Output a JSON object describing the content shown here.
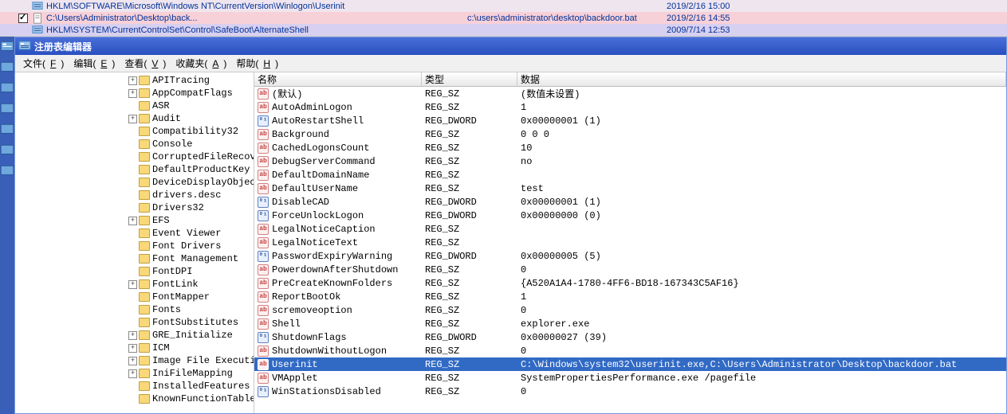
{
  "top_results": [
    {
      "checkbox": null,
      "icon": "reg",
      "path": "HKLM\\SOFTWARE\\Microsoft\\Windows NT\\CurrentVersion\\Winlogon\\Userinit",
      "value": "",
      "date": "2019/2/16 15:00",
      "style": "odd"
    },
    {
      "checkbox": true,
      "icon": "doc",
      "path": "C:\\Users\\Administrator\\Desktop\\back...",
      "value": "c:\\users\\administrator\\desktop\\backdoor.bat",
      "date": "2019/2/16 14:55",
      "style": "pink"
    },
    {
      "checkbox": null,
      "icon": "reg",
      "path": "HKLM\\SYSTEM\\CurrentControlSet\\Control\\SafeBoot\\AlternateShell",
      "value": "",
      "date": "2009/7/14 12:53",
      "style": "blue"
    }
  ],
  "window_title": "注册表编辑器",
  "menu": [
    {
      "label": "文件",
      "key": "F"
    },
    {
      "label": "编辑",
      "key": "E"
    },
    {
      "label": "查看",
      "key": "V"
    },
    {
      "label": "收藏夹",
      "key": "A"
    },
    {
      "label": "帮助",
      "key": "H"
    }
  ],
  "tree_indent": 142,
  "tree": [
    {
      "exp": "+",
      "label": "APITracing"
    },
    {
      "exp": "+",
      "label": "AppCompatFlags"
    },
    {
      "exp": "",
      "label": "ASR"
    },
    {
      "exp": "+",
      "label": "Audit"
    },
    {
      "exp": "",
      "label": "Compatibility32"
    },
    {
      "exp": "",
      "label": "Console"
    },
    {
      "exp": "",
      "label": "CorruptedFileRecove"
    },
    {
      "exp": "",
      "label": "DefaultProductKey"
    },
    {
      "exp": "",
      "label": "DeviceDisplayObject"
    },
    {
      "exp": "",
      "label": "drivers.desc"
    },
    {
      "exp": "",
      "label": "Drivers32"
    },
    {
      "exp": "+",
      "label": "EFS"
    },
    {
      "exp": "",
      "label": "Event Viewer"
    },
    {
      "exp": "",
      "label": "Font Drivers"
    },
    {
      "exp": "",
      "label": "Font Management"
    },
    {
      "exp": "",
      "label": "FontDPI"
    },
    {
      "exp": "+",
      "label": "FontLink"
    },
    {
      "exp": "",
      "label": "FontMapper"
    },
    {
      "exp": "",
      "label": "Fonts"
    },
    {
      "exp": "",
      "label": "FontSubstitutes"
    },
    {
      "exp": "+",
      "label": "GRE_Initialize"
    },
    {
      "exp": "+",
      "label": "ICM"
    },
    {
      "exp": "+",
      "label": "Image File Executi"
    },
    {
      "exp": "+",
      "label": "IniFileMapping"
    },
    {
      "exp": "",
      "label": "InstalledFeatures"
    },
    {
      "exp": "",
      "label": "KnownFunctionTableL"
    }
  ],
  "columns": {
    "name": "名称",
    "type": "类型",
    "data": "数据"
  },
  "values": [
    {
      "icon": "str",
      "name": "(默认)",
      "type": "REG_SZ",
      "data": "(数值未设置)",
      "selected": false
    },
    {
      "icon": "str",
      "name": "AutoAdminLogon",
      "type": "REG_SZ",
      "data": "1",
      "selected": false
    },
    {
      "icon": "bin",
      "name": "AutoRestartShell",
      "type": "REG_DWORD",
      "data": "0x00000001 (1)",
      "selected": false
    },
    {
      "icon": "str",
      "name": "Background",
      "type": "REG_SZ",
      "data": "0 0 0",
      "selected": false
    },
    {
      "icon": "str",
      "name": "CachedLogonsCount",
      "type": "REG_SZ",
      "data": "10",
      "selected": false
    },
    {
      "icon": "str",
      "name": "DebugServerCommand",
      "type": "REG_SZ",
      "data": "no",
      "selected": false
    },
    {
      "icon": "str",
      "name": "DefaultDomainName",
      "type": "REG_SZ",
      "data": "",
      "selected": false
    },
    {
      "icon": "str",
      "name": "DefaultUserName",
      "type": "REG_SZ",
      "data": "test",
      "selected": false
    },
    {
      "icon": "bin",
      "name": "DisableCAD",
      "type": "REG_DWORD",
      "data": "0x00000001 (1)",
      "selected": false
    },
    {
      "icon": "bin",
      "name": "ForceUnlockLogon",
      "type": "REG_DWORD",
      "data": "0x00000000 (0)",
      "selected": false
    },
    {
      "icon": "str",
      "name": "LegalNoticeCaption",
      "type": "REG_SZ",
      "data": "",
      "selected": false
    },
    {
      "icon": "str",
      "name": "LegalNoticeText",
      "type": "REG_SZ",
      "data": "",
      "selected": false
    },
    {
      "icon": "bin",
      "name": "PasswordExpiryWarning",
      "type": "REG_DWORD",
      "data": "0x00000005 (5)",
      "selected": false
    },
    {
      "icon": "str",
      "name": "PowerdownAfterShutdown",
      "type": "REG_SZ",
      "data": "0",
      "selected": false
    },
    {
      "icon": "str",
      "name": "PreCreateKnownFolders",
      "type": "REG_SZ",
      "data": "{A520A1A4-1780-4FF6-BD18-167343C5AF16}",
      "selected": false
    },
    {
      "icon": "str",
      "name": "ReportBootOk",
      "type": "REG_SZ",
      "data": "1",
      "selected": false
    },
    {
      "icon": "str",
      "name": "scremoveoption",
      "type": "REG_SZ",
      "data": "0",
      "selected": false
    },
    {
      "icon": "str",
      "name": "Shell",
      "type": "REG_SZ",
      "data": "explorer.exe",
      "selected": false
    },
    {
      "icon": "bin",
      "name": "ShutdownFlags",
      "type": "REG_DWORD",
      "data": "0x00000027 (39)",
      "selected": false
    },
    {
      "icon": "str",
      "name": "ShutdownWithoutLogon",
      "type": "REG_SZ",
      "data": "0",
      "selected": false
    },
    {
      "icon": "str",
      "name": "Userinit",
      "type": "REG_SZ",
      "data": "C:\\Windows\\system32\\userinit.exe,C:\\Users\\Administrator\\Desktop\\backdoor.bat",
      "selected": true
    },
    {
      "icon": "str",
      "name": "VMApplet",
      "type": "REG_SZ",
      "data": "SystemPropertiesPerformance.exe /pagefile",
      "selected": false
    },
    {
      "icon": "bin",
      "name": "WinStationsDisabled",
      "type": "REG_SZ",
      "data": "0",
      "selected": false
    }
  ]
}
